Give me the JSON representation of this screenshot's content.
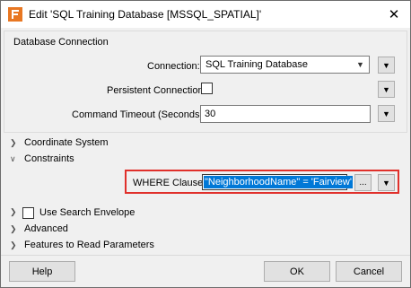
{
  "window": {
    "title": "Edit 'SQL Training Database [MSSQL_SPATIAL]'",
    "close_glyph": "✕",
    "icon": "fme-app-icon"
  },
  "database_connection": {
    "group_title": "Database Connection",
    "connection_label": "Connection:",
    "connection_value": "SQL Training Database",
    "persistent_label": "Persistent Connection:",
    "persistent_checked": false,
    "timeout_label": "Command Timeout (Seconds):",
    "timeout_value": "30"
  },
  "sections": {
    "coordinate_system": "Coordinate System",
    "constraints": "Constraints",
    "use_search_envelope": "Use Search Envelope",
    "advanced": "Advanced",
    "features_to_read": "Features to Read Parameters"
  },
  "constraints": {
    "where_label": "WHERE Clause:",
    "where_value": "\"NeighborhoodName\" = 'Fairview'",
    "ellipsis_label": "..."
  },
  "buttons": {
    "help": "Help",
    "ok": "OK",
    "cancel": "Cancel"
  },
  "colors": {
    "highlight": "#e0302b",
    "selection": "#0078d7"
  }
}
